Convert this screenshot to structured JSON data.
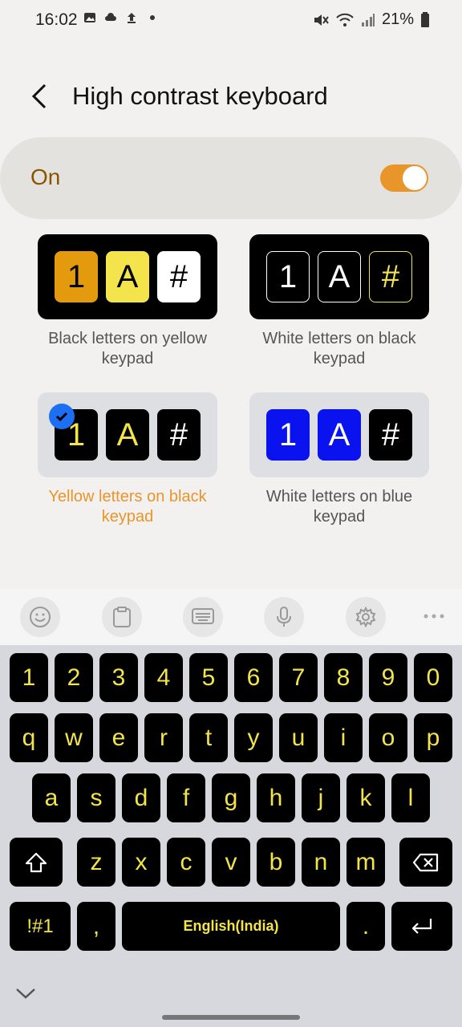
{
  "status_bar": {
    "time": "16:02",
    "battery": "21%"
  },
  "header": {
    "title": "High contrast keyboard"
  },
  "toggle": {
    "label": "On",
    "state": "on",
    "accent": "#e8952a"
  },
  "options": [
    {
      "caption": "Black letters on yellow keypad",
      "keys": [
        "1",
        "A",
        "#"
      ],
      "selected": false
    },
    {
      "caption": "White letters on black keypad",
      "keys": [
        "1",
        "A",
        "#"
      ],
      "selected": false
    },
    {
      "caption": "Yellow letters on black keypad",
      "keys": [
        "1",
        "A",
        "#"
      ],
      "selected": true
    },
    {
      "caption": "White letters on blue keypad",
      "keys": [
        "1",
        "A",
        "#"
      ],
      "selected": false
    }
  ],
  "toolbar": {
    "icons": [
      "emoji-icon",
      "clipboard-icon",
      "keyboard-icon",
      "microphone-icon",
      "settings-icon",
      "more-icon"
    ]
  },
  "keyboard": {
    "row1": [
      "1",
      "2",
      "3",
      "4",
      "5",
      "6",
      "7",
      "8",
      "9",
      "0"
    ],
    "row2": [
      "q",
      "w",
      "e",
      "r",
      "t",
      "y",
      "u",
      "i",
      "o",
      "p"
    ],
    "row3": [
      "a",
      "s",
      "d",
      "f",
      "g",
      "h",
      "j",
      "k",
      "l"
    ],
    "row4": [
      "z",
      "x",
      "c",
      "v",
      "b",
      "n",
      "m"
    ],
    "symbols_label": "!#1",
    "comma_label": ",",
    "space_label": "English(India)",
    "period_label": "."
  }
}
